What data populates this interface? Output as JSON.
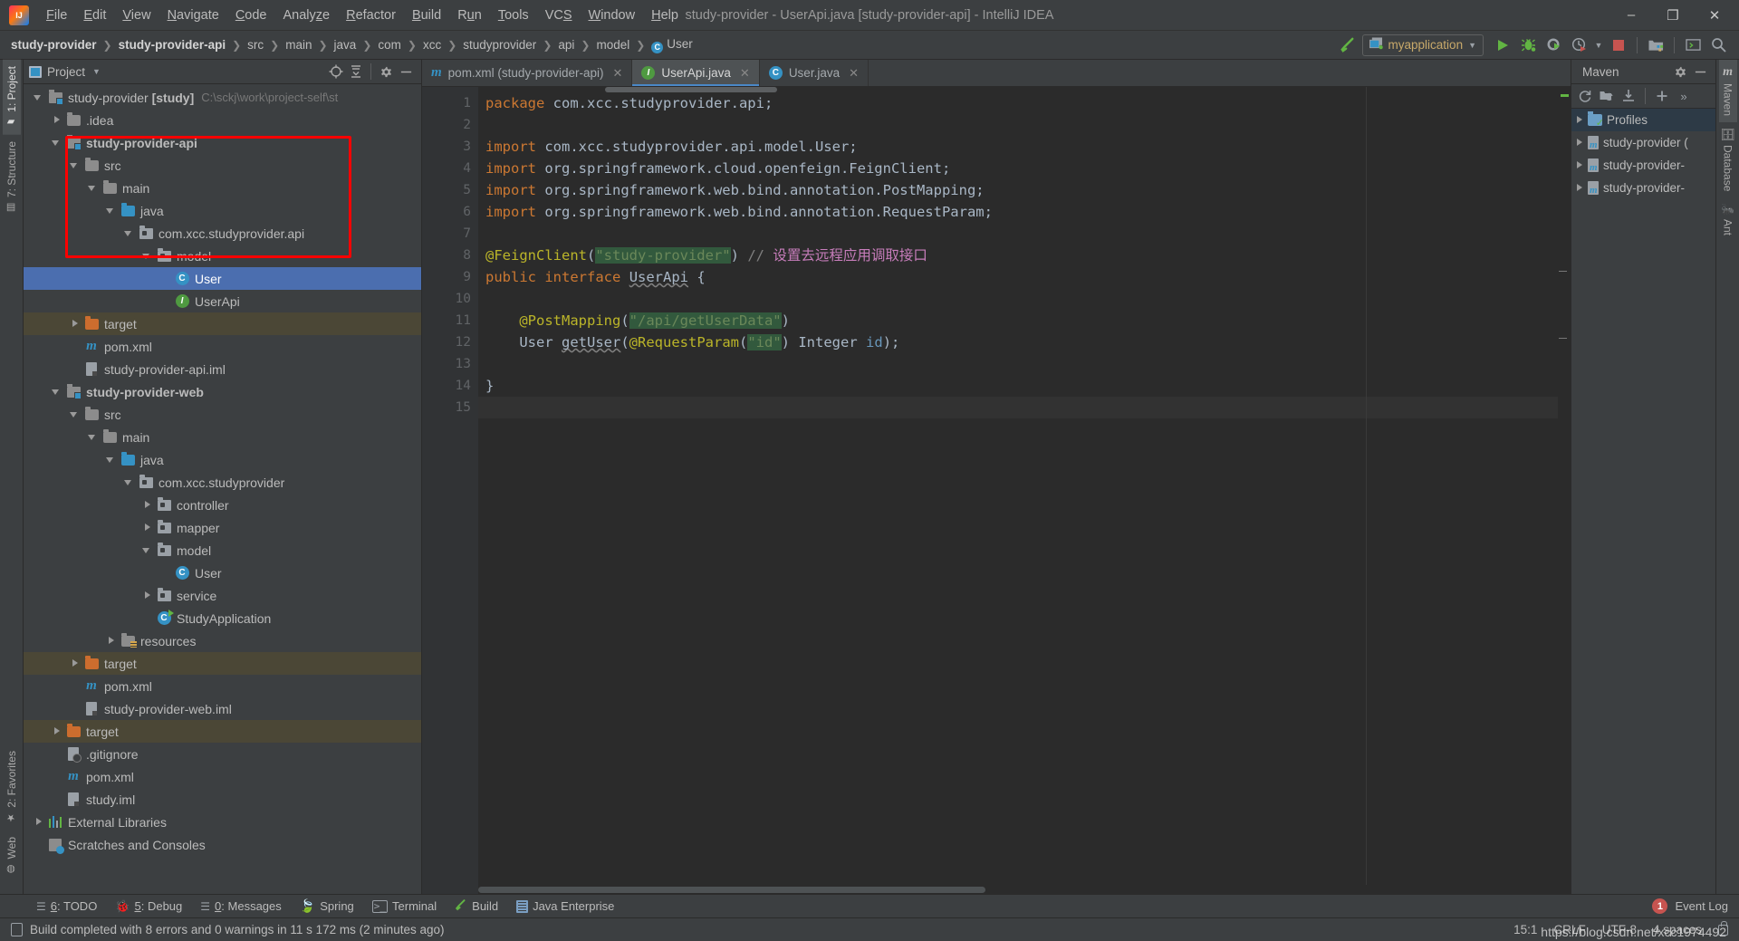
{
  "window": {
    "title": "study-provider - UserApi.java [study-provider-api] - IntelliJ IDEA",
    "minimize": "–",
    "maximize": "❐",
    "close": "✕"
  },
  "menu": [
    {
      "label": "File"
    },
    {
      "label": "Edit"
    },
    {
      "label": "View"
    },
    {
      "label": "Navigate"
    },
    {
      "label": "Code"
    },
    {
      "label": "Analyze"
    },
    {
      "label": "Refactor"
    },
    {
      "label": "Build"
    },
    {
      "label": "Run"
    },
    {
      "label": "Tools"
    },
    {
      "label": "VCS"
    },
    {
      "label": "Window"
    },
    {
      "label": "Help"
    }
  ],
  "breadcrumbs": [
    {
      "label": "study-provider",
      "bold": true
    },
    {
      "label": "study-provider-api",
      "bold": true
    },
    {
      "label": "src",
      "bold": false
    },
    {
      "label": "main",
      "bold": false
    },
    {
      "label": "java",
      "bold": false
    },
    {
      "label": "com",
      "bold": false
    },
    {
      "label": "xcc",
      "bold": false
    },
    {
      "label": "studyprovider",
      "bold": false
    },
    {
      "label": "api",
      "bold": false
    },
    {
      "label": "model",
      "bold": false
    },
    {
      "label": "User",
      "bold": false,
      "icon": "class-icon",
      "icon_letter": "C"
    }
  ],
  "toolbar": {
    "build_icon": "hammer-icon",
    "run_config": {
      "label": "myapplication",
      "icon": "run-config-icon",
      "caret": "▼"
    },
    "run_button": "run-icon",
    "debug_button": "debug-icon",
    "run_coverage_button": "run-with-coverage-icon",
    "profiler_button": "profiler-icon",
    "profiler_caret": "▼",
    "stop_button": "stop-icon",
    "project_structure_button": "project-structure-icon",
    "terminal_button": "terminal-icon",
    "search_button": "search-everywhere-icon"
  },
  "left_rail": [
    {
      "label": "1: Project",
      "underline": "1",
      "icon": "project-folder-icon",
      "active": true
    },
    {
      "label": "7: Structure",
      "underline": "7",
      "icon": "structure-icon",
      "active": false
    },
    {
      "label": "2: Favorites",
      "underline": "2",
      "icon": "star-icon",
      "active": false
    },
    {
      "label": "Web",
      "underline": "",
      "icon": "web-icon",
      "active": false
    }
  ],
  "right_rail": [
    {
      "label": "Maven",
      "icon": "maven-m-icon"
    },
    {
      "label": "Database",
      "icon": "database-icon"
    },
    {
      "label": "Ant",
      "icon": "ant-icon"
    }
  ],
  "project_panel": {
    "title": "Project",
    "caret": "▼",
    "icon": "project-view-icon",
    "locate_icon": "locate-icon",
    "collapse_icon": "collapse-all-icon",
    "settings_icon": "gear-icon",
    "hide_icon": "hide-icon",
    "tree": [
      {
        "indent": 0,
        "arrow": "open",
        "icon": "module-icon",
        "label": "study-provider [study]",
        "bold_part": "[study]",
        "path": "C:\\sckj\\work\\project-self\\st",
        "state": "normal"
      },
      {
        "indent": 1,
        "arrow": "closed",
        "icon": "folder-grey",
        "label": ".idea",
        "state": "normal"
      },
      {
        "indent": 1,
        "arrow": "open",
        "icon": "module-icon",
        "label": "study-provider-api",
        "bold": true,
        "state": "normal"
      },
      {
        "indent": 2,
        "arrow": "open",
        "icon": "folder-grey",
        "label": "src",
        "state": "normal"
      },
      {
        "indent": 3,
        "arrow": "open",
        "icon": "folder-grey",
        "label": "main",
        "state": "normal"
      },
      {
        "indent": 4,
        "arrow": "open",
        "icon": "folder-blue",
        "label": "java",
        "state": "normal"
      },
      {
        "indent": 5,
        "arrow": "open",
        "icon": "package-icon",
        "label": "com.xcc.studyprovider.api",
        "state": "normal"
      },
      {
        "indent": 6,
        "arrow": "open",
        "icon": "package-icon",
        "label": "model",
        "state": "normal"
      },
      {
        "indent": 7,
        "arrow": "none",
        "icon": "class-icon",
        "label": "User",
        "state": "selected"
      },
      {
        "indent": 7,
        "arrow": "none",
        "icon": "interface-icon",
        "label": "UserApi",
        "state": "normal"
      },
      {
        "indent": 2,
        "arrow": "closed",
        "icon": "folder-orange",
        "label": "target",
        "state": "target"
      },
      {
        "indent": 2,
        "arrow": "none",
        "icon": "maven-icon",
        "label": "pom.xml",
        "state": "normal"
      },
      {
        "indent": 2,
        "arrow": "none",
        "icon": "iml-icon",
        "label": "study-provider-api.iml",
        "state": "normal"
      },
      {
        "indent": 1,
        "arrow": "open",
        "icon": "module-icon",
        "label": "study-provider-web",
        "bold": true,
        "state": "normal"
      },
      {
        "indent": 2,
        "arrow": "open",
        "icon": "folder-grey",
        "label": "src",
        "state": "normal"
      },
      {
        "indent": 3,
        "arrow": "open",
        "icon": "folder-grey",
        "label": "main",
        "state": "normal"
      },
      {
        "indent": 4,
        "arrow": "open",
        "icon": "folder-blue",
        "label": "java",
        "state": "normal"
      },
      {
        "indent": 5,
        "arrow": "open",
        "icon": "package-icon",
        "label": "com.xcc.studyprovider",
        "state": "normal"
      },
      {
        "indent": 6,
        "arrow": "closed",
        "icon": "package-icon",
        "label": "controller",
        "state": "normal"
      },
      {
        "indent": 6,
        "arrow": "closed",
        "icon": "package-icon",
        "label": "mapper",
        "state": "normal"
      },
      {
        "indent": 6,
        "arrow": "open",
        "icon": "package-icon",
        "label": "model",
        "state": "normal"
      },
      {
        "indent": 7,
        "arrow": "none",
        "icon": "class-icon",
        "label": "User",
        "state": "normal"
      },
      {
        "indent": 6,
        "arrow": "closed",
        "icon": "package-icon",
        "label": "service",
        "state": "normal"
      },
      {
        "indent": 6,
        "arrow": "none",
        "icon": "runnable-class-icon",
        "label": "StudyApplication",
        "state": "normal"
      },
      {
        "indent": 4,
        "arrow": "closed",
        "icon": "resources-icon",
        "label": "resources",
        "state": "normal"
      },
      {
        "indent": 2,
        "arrow": "closed",
        "icon": "folder-orange",
        "label": "target",
        "state": "target"
      },
      {
        "indent": 2,
        "arrow": "none",
        "icon": "maven-icon",
        "label": "pom.xml",
        "state": "normal"
      },
      {
        "indent": 2,
        "arrow": "none",
        "icon": "iml-icon",
        "label": "study-provider-web.iml",
        "state": "normal"
      },
      {
        "indent": 1,
        "arrow": "closed",
        "icon": "folder-orange",
        "label": "target",
        "state": "target"
      },
      {
        "indent": 1,
        "arrow": "none",
        "icon": "gitignore-icon",
        "label": ".gitignore",
        "state": "normal"
      },
      {
        "indent": 1,
        "arrow": "none",
        "icon": "maven-icon",
        "label": "pom.xml",
        "state": "normal"
      },
      {
        "indent": 1,
        "arrow": "none",
        "icon": "iml-icon",
        "label": "study.iml",
        "state": "normal"
      },
      {
        "indent": 0,
        "arrow": "closed",
        "icon": "libraries-icon",
        "label": "External Libraries",
        "state": "normal"
      },
      {
        "indent": 0,
        "arrow": "none",
        "icon": "scratches-icon",
        "label": "Scratches and Consoles",
        "state": "normal"
      }
    ]
  },
  "editor": {
    "tabs": [
      {
        "label": "pom.xml (study-provider-api)",
        "icon": "maven-icon",
        "active": false,
        "close": "✕"
      },
      {
        "label": "UserApi.java",
        "icon": "interface-icon",
        "active": true,
        "close": "✕"
      },
      {
        "label": "User.java",
        "icon": "class-icon",
        "active": false,
        "close": "✕"
      }
    ],
    "line_numbers": [
      "1",
      "2",
      "3",
      "4",
      "5",
      "6",
      "7",
      "8",
      "9",
      "10",
      "11",
      "12",
      "13",
      "14",
      "15"
    ],
    "code_lines": [
      {
        "n": 1,
        "text": "package com.xcc.studyprovider.api;"
      },
      {
        "n": 2,
        "text": ""
      },
      {
        "n": 3,
        "text": "import com.xcc.studyprovider.api.model.User;"
      },
      {
        "n": 4,
        "text": "import org.springframework.cloud.openfeign.FeignClient;"
      },
      {
        "n": 5,
        "text": "import org.springframework.web.bind.annotation.PostMapping;"
      },
      {
        "n": 6,
        "text": "import org.springframework.web.bind.annotation.RequestParam;"
      },
      {
        "n": 7,
        "text": ""
      },
      {
        "n": 8,
        "text": "@FeignClient(\"study-provider\") // 设置去远程应用调取接口"
      },
      {
        "n": 9,
        "text": "public interface UserApi {"
      },
      {
        "n": 10,
        "text": ""
      },
      {
        "n": 11,
        "text": "    @PostMapping(\"/api/getUserData\")"
      },
      {
        "n": 12,
        "text": "    User getUser(@RequestParam(\"id\") Integer id);"
      },
      {
        "n": 13,
        "text": ""
      },
      {
        "n": 14,
        "text": "}"
      },
      {
        "n": 15,
        "text": ""
      }
    ],
    "comment_chinese": "设置去远程应用调取接口"
  },
  "maven_panel": {
    "title": "Maven",
    "settings_icon": "gear-icon",
    "hide_icon": "hide-icon",
    "toolbar": [
      "reimport-icon",
      "generate-sources-icon",
      "download-sources-icon",
      "add-icon",
      "more-icon"
    ],
    "tree": [
      {
        "label": "Profiles",
        "icon": "profiles-icon",
        "arrow": "closed",
        "selected": true
      },
      {
        "label": "study-provider (",
        "icon": "maven-project-icon",
        "arrow": "closed",
        "selected": false
      },
      {
        "label": "study-provider-",
        "icon": "maven-project-icon",
        "arrow": "closed",
        "selected": false
      },
      {
        "label": "study-provider-",
        "icon": "maven-project-icon",
        "arrow": "closed",
        "selected": false
      }
    ]
  },
  "bottom_bar": {
    "items": [
      {
        "label": "6: TODO",
        "underline": "6",
        "icon": "todo-icon"
      },
      {
        "label": "5: Debug",
        "underline": "5",
        "icon": "debug-icon"
      },
      {
        "label": "0: Messages",
        "underline": "0",
        "icon": "messages-icon"
      },
      {
        "label": "Spring",
        "underline": "",
        "icon": "spring-icon"
      },
      {
        "label": "Terminal",
        "underline": "",
        "icon": "terminal-icon"
      },
      {
        "label": "Build",
        "underline": "",
        "icon": "build-icon"
      },
      {
        "label": "Java Enterprise",
        "underline": "",
        "icon": "java-enterprise-icon"
      }
    ],
    "event_log": {
      "label": "Event Log",
      "count": "1"
    }
  },
  "status_bar": {
    "message": "Build completed with 8 errors and 0 warnings in 11 s 172 ms (2 minutes ago)",
    "caret_position": "15:1",
    "line_separator": "CRLF",
    "encoding": "UTF-8",
    "indent": "4 spaces",
    "lock_icon": "lock-icon",
    "watermark": "https://blog.csdn.net/xcc1974492"
  },
  "colors": {
    "background": "#3c3f41",
    "editor_bg": "#2b2b2b",
    "selection": "#4b6eaf",
    "accent_blue": "#3592c4",
    "green": "#62b543",
    "orange": "#cc6d2e",
    "annotation_box": "#ff0000",
    "keyword": "#cc7832",
    "string": "#6a8759",
    "annotation": "#bbb529",
    "comment": "#808080",
    "comment_cn": "#c77dbb",
    "error_red": "#c75450"
  }
}
